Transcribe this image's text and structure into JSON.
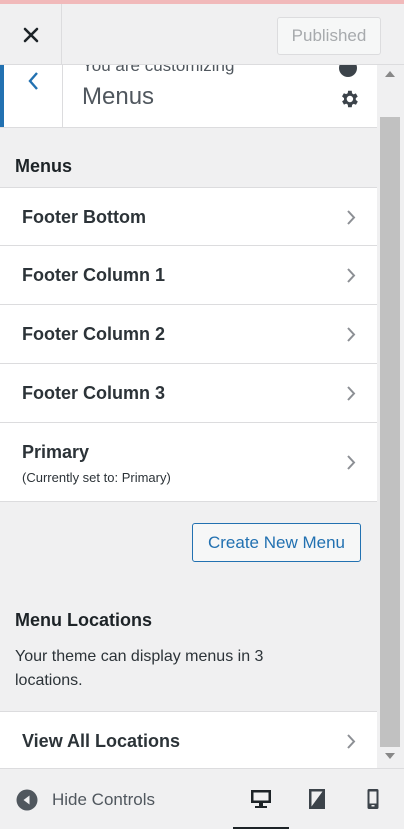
{
  "header": {
    "close_label": "Close",
    "publish_label": "Published"
  },
  "panel": {
    "breadcrumb": "You are customizing",
    "title": "Menus",
    "menus_heading": "Menus",
    "menus": [
      {
        "label": "Footer Bottom",
        "sub": ""
      },
      {
        "label": "Footer Column 1",
        "sub": ""
      },
      {
        "label": "Footer Column 2",
        "sub": ""
      },
      {
        "label": "Footer Column 3",
        "sub": ""
      },
      {
        "label": "Primary",
        "sub": "(Currently set to: Primary)"
      }
    ],
    "create_label": "Create New Menu",
    "locations_heading": "Menu Locations",
    "locations_desc": "Your theme can display menus in 3 locations.",
    "view_all_label": "View All Locations"
  },
  "footer": {
    "hide_controls_label": "Hide Controls",
    "devices": [
      "desktop-icon",
      "tablet-icon",
      "mobile-icon"
    ],
    "active_device": "desktop"
  },
  "colors": {
    "accent": "#2271b1",
    "panel_bg": "#f0f0f1"
  }
}
